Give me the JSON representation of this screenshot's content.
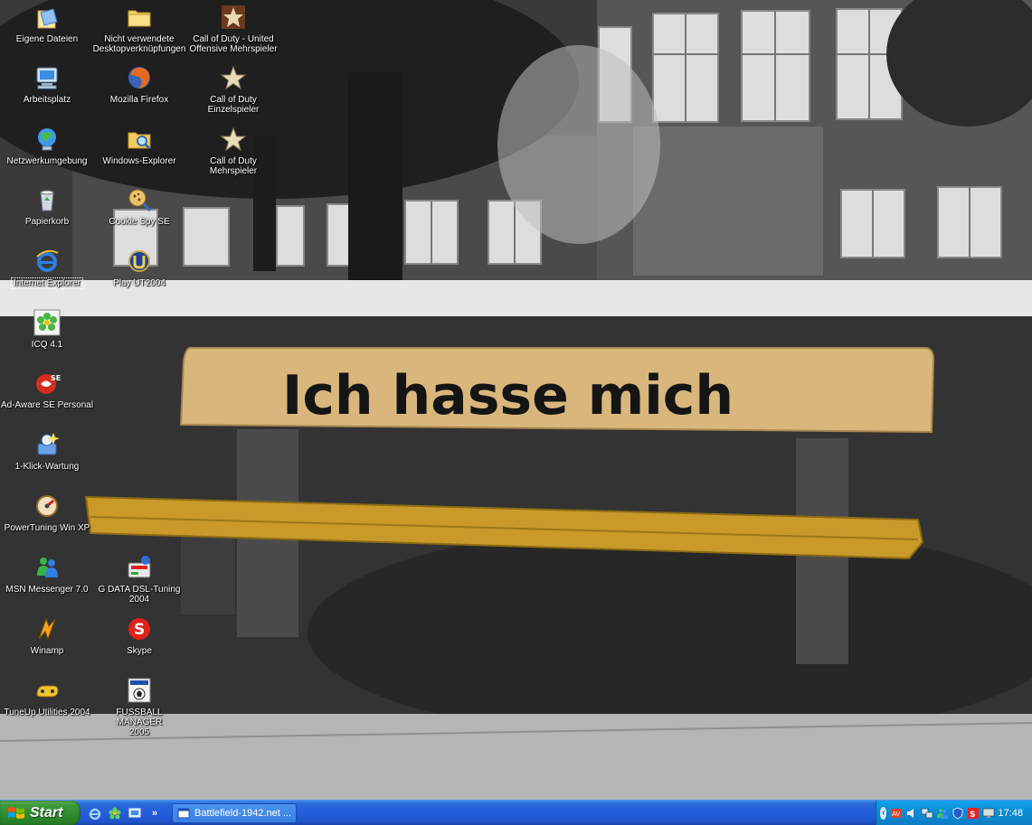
{
  "desktop": {
    "icons": [
      {
        "label": "Eigene Dateien",
        "icon": "my-documents-icon"
      },
      {
        "label": "Nicht verwendete\nDesktopverknüpfungen",
        "icon": "folder-icon"
      },
      {
        "label": "Call of Duty - United\nOffensive Mehrspieler",
        "icon": "call-of-duty-star-icon"
      },
      {
        "label": "Arbeitsplatz",
        "icon": "my-computer-icon"
      },
      {
        "label": "Mozilla Firefox",
        "icon": "firefox-icon"
      },
      {
        "label": "Call of Duty\nEinzelspieler",
        "icon": "call-of-duty-star-icon"
      },
      {
        "label": "Netzwerkumgebung",
        "icon": "network-places-icon"
      },
      {
        "label": "Windows-Explorer",
        "icon": "windows-explorer-icon"
      },
      {
        "label": "Call of Duty\nMehrspieler",
        "icon": "call-of-duty-star-icon"
      },
      {
        "label": "Papierkorb",
        "icon": "recycle-bin-icon"
      },
      {
        "label": "Cookie Spy SE",
        "icon": "cookie-spy-icon"
      },
      {
        "label": "Internet Explorer",
        "icon": "internet-explorer-icon"
      },
      {
        "label": "Play UT2004",
        "icon": "ut2004-icon"
      },
      {
        "label": "ICQ 4.1",
        "icon": "icq-flower-icon"
      },
      {
        "label": "Ad-Aware SE Personal",
        "icon": "ad-aware-icon"
      },
      {
        "label": "1-Klick-Wartung",
        "icon": "one-click-maintenance-icon"
      },
      {
        "label": "PowerTuning Win XP",
        "icon": "powertuning-icon"
      },
      {
        "label": "MSN Messenger 7.0",
        "icon": "msn-messenger-icon"
      },
      {
        "label": "G DATA DSL-Tuning\n2004",
        "icon": "gdata-dsl-icon"
      },
      {
        "label": "Winamp",
        "icon": "winamp-icon"
      },
      {
        "label": "Skype",
        "icon": "skype-icon"
      },
      {
        "label": "TuneUp Utilities 2004",
        "icon": "tuneup-icon"
      },
      {
        "label": "FUSSBALL MANAGER\n2005",
        "icon": "fussball-manager-icon"
      }
    ]
  },
  "wallpaper": {
    "bench_graffiti": "Ich hasse mich"
  },
  "taskbar": {
    "start_label": "Start",
    "quicklaunch": [
      "internet-explorer-icon",
      "icq-flower-icon",
      "show-desktop-icon"
    ],
    "quicklaunch_more": "»",
    "task_button_label": "Battlefield-1942.net ...",
    "tray_toggle": "‹",
    "tray_icons": [
      "antivirus-icon",
      "volume-icon",
      "network-icon",
      "msn-tray-icon",
      "security-shield-icon",
      "skype-tray-icon",
      "monitor-icon"
    ],
    "clock": "17:48"
  },
  "colors": {
    "taskbar_blue": "#245edb",
    "start_green": "#3c9a3b",
    "tray_blue": "#0e8ed8",
    "bench_wood": "#d9b77c",
    "bench_seat": "#c99a2a"
  }
}
